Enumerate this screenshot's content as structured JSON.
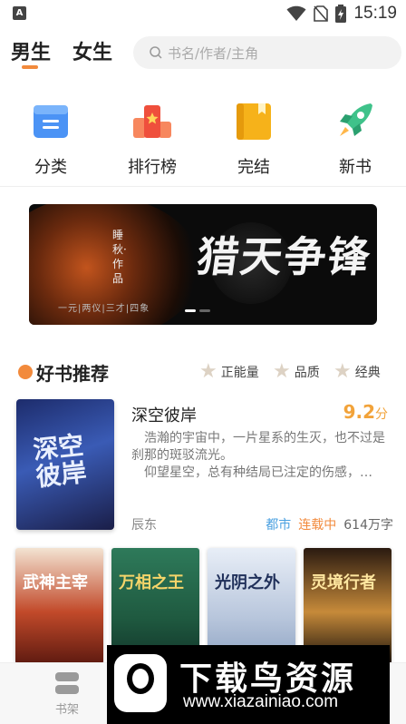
{
  "status_bar": {
    "time": "15:19",
    "notification_badge": "A",
    "icons": [
      "wifi-icon",
      "no-sim-icon",
      "battery-charging-icon"
    ]
  },
  "header": {
    "tabs": [
      {
        "label": "男生",
        "active": true
      },
      {
        "label": "女生",
        "active": false
      }
    ],
    "search_placeholder": "书名/作者/主角",
    "accent_color": "#f28a3c"
  },
  "categories": [
    {
      "label": "分类",
      "icon": "list-doc-icon"
    },
    {
      "label": "排行榜",
      "icon": "ranking-podium-icon"
    },
    {
      "label": "完结",
      "icon": "finished-book-icon"
    },
    {
      "label": "新书",
      "icon": "rocket-icon"
    }
  ],
  "banner": {
    "author": "睡秋·作品",
    "title": "猎天争锋",
    "subtitle": "一元|两仪|三才|四象",
    "slide_count": 2,
    "active_slide": 1
  },
  "section": {
    "title": "好书推荐",
    "filters": [
      "正能量",
      "品质",
      "经典"
    ]
  },
  "featured_book": {
    "title": "深空彼岸",
    "cover_text": "深空彼岸",
    "score": "9.2",
    "score_unit": "分",
    "description_1": "浩瀚的宇宙中，一片星系的生灭，也不过是刹那的斑驳流光。",
    "description_2": "仰望星空，总有种结局已注定的伤感，…",
    "author": "辰东",
    "genre": "都市",
    "status": "连载中",
    "words": "614万字"
  },
  "covers": [
    {
      "text": "武神主宰"
    },
    {
      "text": "万相之王"
    },
    {
      "text": "光阴之外"
    },
    {
      "text": "灵境行者"
    }
  ],
  "bottom_nav": {
    "bookshelf_label": "书架"
  },
  "watermark": {
    "title": "下载鸟资源",
    "url": "www.xiazainiao.com"
  }
}
